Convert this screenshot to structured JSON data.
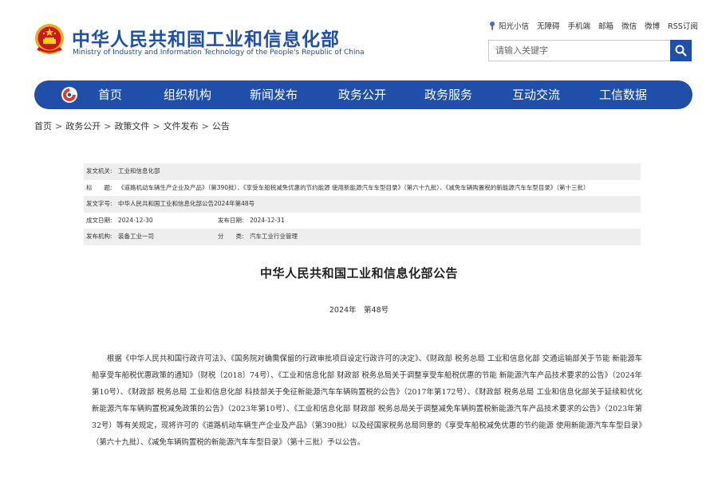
{
  "header": {
    "site_title": "中华人民共和国工业和信息化部",
    "site_subtitle": "Ministry of Industry and Information Technology of the People's Republic of China",
    "emblem_icon": "national-emblem-icon",
    "brand_color": "#1f4fa8"
  },
  "top_links": [
    "阳光小信",
    "无障碍",
    "手机端",
    "邮箱",
    "微信",
    "微博",
    "RSS订阅"
  ],
  "search": {
    "placeholder": "请输入关键字",
    "icon": "search-icon"
  },
  "nav": {
    "logo_icon": "miit-logo-icon",
    "items": [
      "首页",
      "组织机构",
      "新闻发布",
      "政务公开",
      "政务服务",
      "互动交流",
      "工信数据"
    ]
  },
  "breadcrumb": [
    "首页",
    "政务公开",
    "政策文件",
    "文件发布",
    "公告"
  ],
  "meta": {
    "issuer_label": "发文机关:",
    "issuer": "工业和信息化部",
    "subject_label": "标　　题:",
    "subject": "《道路机动车辆生产企业及产品》（第390批）、《享受车船税减免优惠的节约能源 使用新能源汽车车型目录》（第六十九批）、《减免车辆购置税的新能源汽车车型目录》（第十三批）",
    "doc_number_label": "发文字号:",
    "doc_number": "中华人民共和国工业和信息化部公告2024年第48号",
    "date_written_label": "成文日期:",
    "date_written": "2024-12-30",
    "date_published_label": "发布日期:",
    "date_published": "2024-12-31",
    "org_label": "发布机构:",
    "org": "装备工业一司",
    "category_label": "分　　类:",
    "category": "汽车工业行业管理"
  },
  "document": {
    "title": "中华人民共和国工业和信息化部公告",
    "number": "2024年　第48号",
    "body": "根据《中华人民共和国行政许可法》、《国务院对确需保留的行政审批项目设定行政许可的决定》、《财政部 税务总局 工业和信息化部 交通运输部关于节能 新能源车船享受车船税优惠政策的通知》（财税〔2018〕74号）、《工业和信息化部 财政部 税务总局关于调整享受车船税优惠的节能 新能源汽车产品技术要求的公告》（2024年第10号）、《财政部 税务总局 工业和信息化部 科技部关于免征新能源汽车车辆购置税的公告》（2017年第172号）、《财政部 税务总局 工业和信息化部关于延续和优化新能源汽车车辆购置税减免政策的公告》（2023年第10号）、《工业和信息化部 财政部 税务总局关于调整减免车辆购置税新能源汽车产品技术要求的公告》（2023年第32号）等有关规定，现将许可的《道路机动车辆生产企业及产品》（第390批）以及经国家税务总局同意的《享受车船税减免优惠的节约能源 使用新能源汽车车型目录》（第六十九批）、《减免车辆购置税的新能源汽车车型目录》（第十三批）予以公告。"
  }
}
